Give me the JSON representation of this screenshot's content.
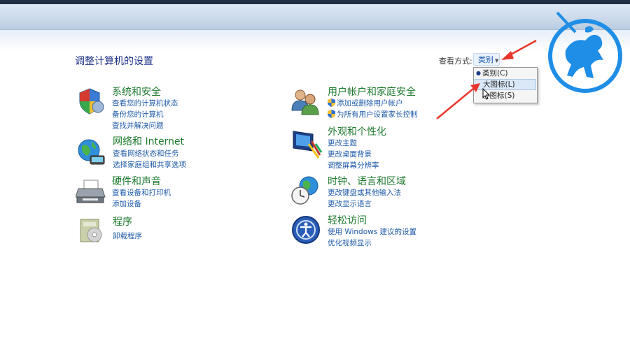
{
  "header": {
    "title": "调整计算机的设置",
    "view_by_label": "查看方式:",
    "view_by_value": "类别",
    "view_menu": [
      {
        "label": "类别(C)",
        "selected": true
      },
      {
        "label": "大图标(L)",
        "selected": false
      },
      {
        "label": "小图标(S)",
        "selected": false
      }
    ]
  },
  "categories": {
    "system": {
      "title": "系统和安全",
      "links": [
        "查看您的计算机状态",
        "备份您的计算机",
        "查找并解决问题"
      ]
    },
    "network": {
      "title": "网络和 Internet",
      "links": [
        "查看网络状态和任务",
        "选择家庭组和共享选项"
      ]
    },
    "hardware": {
      "title": "硬件和声音",
      "links": [
        "查看设备和打印机",
        "添加设备"
      ]
    },
    "programs": {
      "title": "程序",
      "links": [
        "卸载程序"
      ]
    },
    "users": {
      "title": "用户帐户和家庭安全",
      "links": [
        "添加或删除用户帐户",
        "为所有用户设置家长控制"
      ]
    },
    "appearance": {
      "title": "外观和个性化",
      "links": [
        "更改主题",
        "更改桌面背景",
        "调整屏幕分辨率"
      ]
    },
    "clock": {
      "title": "时钟、语言和区域",
      "links": [
        "更改键盘或其他输入法",
        "更改显示语言"
      ]
    },
    "ease": {
      "title": "轻松访问",
      "links": [
        "使用 Windows 建议的设置",
        "优化视频显示"
      ]
    }
  },
  "colors": {
    "category_title": "#1e7a2e",
    "link": "#1e5aa8",
    "page_title": "#1e3287",
    "annotation_arrow": "#e8352b",
    "logo": "#1f8ee6"
  }
}
